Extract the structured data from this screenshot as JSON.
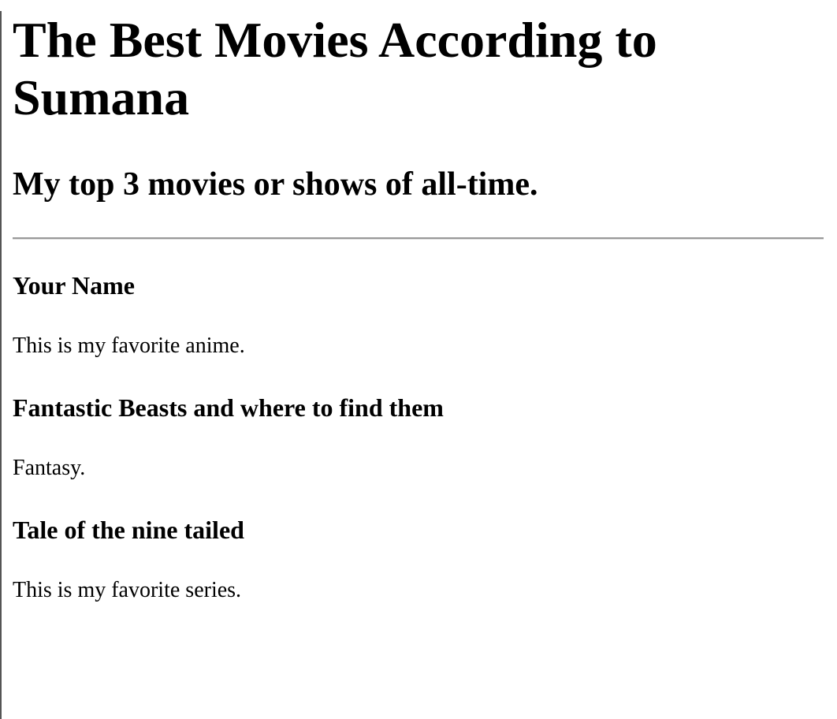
{
  "title": "The Best Movies According to Sumana",
  "subtitle": "My top 3 movies or shows of all-time.",
  "items": [
    {
      "heading": "Your Name",
      "description": "This is my favorite anime."
    },
    {
      "heading": "Fantastic Beasts and where to find them",
      "description": "Fantasy."
    },
    {
      "heading": "Tale of the nine tailed",
      "description": "This is my favorite series."
    }
  ]
}
